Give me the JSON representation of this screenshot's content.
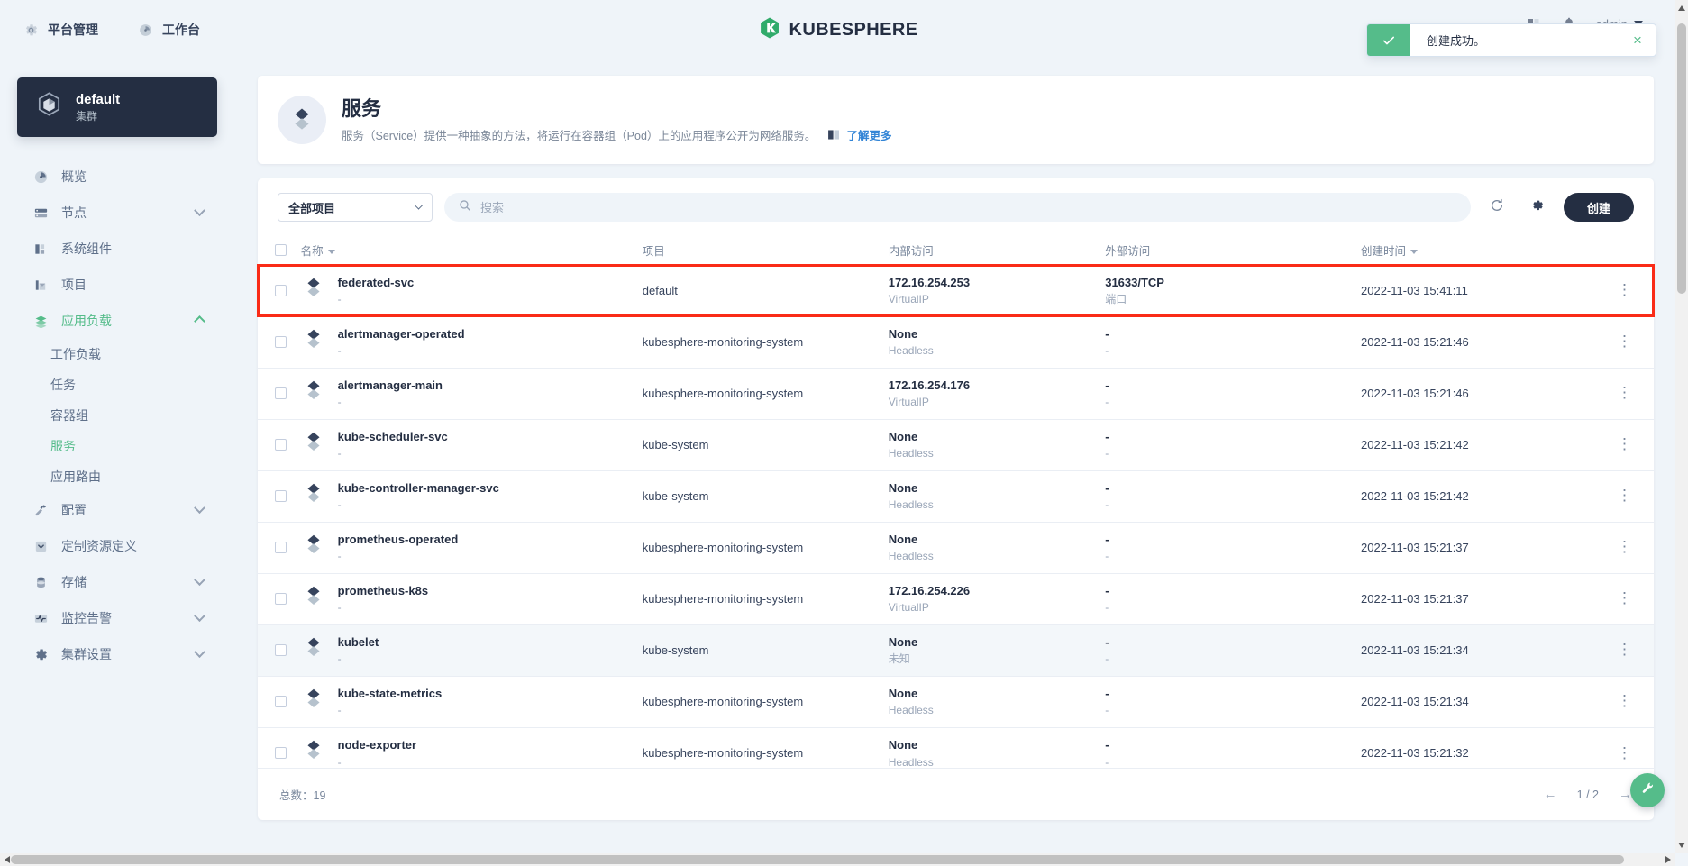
{
  "topbar": {
    "nav": [
      {
        "label": "平台管理",
        "icon": "gear-icon"
      },
      {
        "label": "工作台",
        "icon": "dashboard-icon"
      }
    ],
    "brand": "KUBESPHERE",
    "user": "admin"
  },
  "toast": {
    "message": "创建成功。",
    "icon": "check-icon",
    "close": "×",
    "accent": "#55bc8a"
  },
  "sidebar": {
    "cluster": {
      "name": "default",
      "sub": "集群"
    },
    "items": [
      {
        "label": "概览",
        "icon": "overview-icon",
        "expandable": false,
        "active": false
      },
      {
        "label": "节点",
        "icon": "nodes-icon",
        "expandable": true,
        "active": false
      },
      {
        "label": "系统组件",
        "icon": "components-icon",
        "expandable": false,
        "active": false
      },
      {
        "label": "项目",
        "icon": "projects-icon",
        "expandable": false,
        "active": false
      },
      {
        "label": "应用负载",
        "icon": "workloads-icon",
        "expandable": true,
        "active": true,
        "children": [
          {
            "label": "工作负载",
            "active": false
          },
          {
            "label": "任务",
            "active": false
          },
          {
            "label": "容器组",
            "active": false
          },
          {
            "label": "服务",
            "active": true
          },
          {
            "label": "应用路由",
            "active": false
          }
        ]
      },
      {
        "label": "配置",
        "icon": "config-icon",
        "expandable": true,
        "active": false
      },
      {
        "label": "定制资源定义",
        "icon": "crd-icon",
        "expandable": false,
        "active": false
      },
      {
        "label": "存储",
        "icon": "storage-icon",
        "expandable": true,
        "active": false
      },
      {
        "label": "监控告警",
        "icon": "monitoring-icon",
        "expandable": true,
        "active": false
      },
      {
        "label": "集群设置",
        "icon": "cluster-settings-icon",
        "expandable": true,
        "active": false
      }
    ]
  },
  "page": {
    "title": "服务",
    "description": "服务（Service）提供一种抽象的方法，将运行在容器组（Pod）上的应用程序公开为网络服务。",
    "learn_more": "了解更多"
  },
  "toolbar": {
    "project_filter": "全部项目",
    "search_placeholder": "搜索",
    "search_value": "",
    "refresh_icon": "refresh-icon",
    "settings_icon": "gear-icon",
    "create_label": "创建"
  },
  "table": {
    "columns": [
      "名称",
      "项目",
      "内部访问",
      "外部访问",
      "创建时间"
    ],
    "rows": [
      {
        "name": "federated-svc",
        "name_sub": "-",
        "project": "default",
        "internal": "172.16.254.253",
        "internal_sub": "VirtualIP",
        "external": "31633/TCP",
        "external_sub": "端口",
        "created": "2022-11-03 15:41:11",
        "highlight": true,
        "zebra": false
      },
      {
        "name": "alertmanager-operated",
        "name_sub": "-",
        "project": "kubesphere-monitoring-system",
        "internal": "None",
        "internal_sub": "Headless",
        "external": "-",
        "external_sub": "-",
        "created": "2022-11-03 15:21:46",
        "highlight": false,
        "zebra": false
      },
      {
        "name": "alertmanager-main",
        "name_sub": "-",
        "project": "kubesphere-monitoring-system",
        "internal": "172.16.254.176",
        "internal_sub": "VirtualIP",
        "external": "-",
        "external_sub": "-",
        "created": "2022-11-03 15:21:46",
        "highlight": false,
        "zebra": false
      },
      {
        "name": "kube-scheduler-svc",
        "name_sub": "-",
        "project": "kube-system",
        "internal": "None",
        "internal_sub": "Headless",
        "external": "-",
        "external_sub": "-",
        "created": "2022-11-03 15:21:42",
        "highlight": false,
        "zebra": false
      },
      {
        "name": "kube-controller-manager-svc",
        "name_sub": "-",
        "project": "kube-system",
        "internal": "None",
        "internal_sub": "Headless",
        "external": "-",
        "external_sub": "-",
        "created": "2022-11-03 15:21:42",
        "highlight": false,
        "zebra": false
      },
      {
        "name": "prometheus-operated",
        "name_sub": "-",
        "project": "kubesphere-monitoring-system",
        "internal": "None",
        "internal_sub": "Headless",
        "external": "-",
        "external_sub": "-",
        "created": "2022-11-03 15:21:37",
        "highlight": false,
        "zebra": false
      },
      {
        "name": "prometheus-k8s",
        "name_sub": "-",
        "project": "kubesphere-monitoring-system",
        "internal": "172.16.254.226",
        "internal_sub": "VirtualIP",
        "external": "-",
        "external_sub": "-",
        "created": "2022-11-03 15:21:37",
        "highlight": false,
        "zebra": false
      },
      {
        "name": "kubelet",
        "name_sub": "-",
        "project": "kube-system",
        "internal": "None",
        "internal_sub": "未知",
        "external": "-",
        "external_sub": "-",
        "created": "2022-11-03 15:21:34",
        "highlight": false,
        "zebra": true
      },
      {
        "name": "kube-state-metrics",
        "name_sub": "-",
        "project": "kubesphere-monitoring-system",
        "internal": "None",
        "internal_sub": "Headless",
        "external": "-",
        "external_sub": "-",
        "created": "2022-11-03 15:21:34",
        "highlight": false,
        "zebra": false
      },
      {
        "name": "node-exporter",
        "name_sub": "-",
        "project": "kubesphere-monitoring-system",
        "internal": "None",
        "internal_sub": "Headless",
        "external": "-",
        "external_sub": "-",
        "created": "2022-11-03 15:21:32",
        "highlight": false,
        "zebra": false
      }
    ]
  },
  "footer": {
    "total": "总数：19",
    "page": "1 / 2",
    "prev": "←",
    "next": "→"
  },
  "colors": {
    "accent_green": "#55bc8a",
    "dark": "#242e42",
    "bg": "#eff4f9",
    "highlight_outline": "#fa2b17",
    "link": "#3385d6"
  }
}
